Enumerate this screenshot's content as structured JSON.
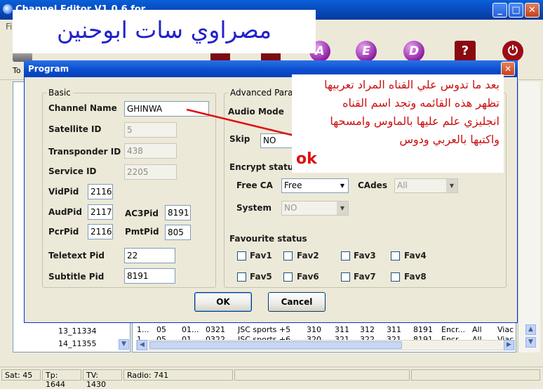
{
  "main_window": {
    "title": "Channel Editor V1.0.6 for ...",
    "menu_first": "File",
    "toolbar_label": "To",
    "overlay_banner": "مصراوي سات  ابوحنين",
    "tool_buttons": [
      "A",
      "E",
      "D",
      "?",
      "⏻"
    ]
  },
  "tree": {
    "items": [
      "13_11334",
      "14_11355"
    ]
  },
  "grid": {
    "rows": [
      [
        "1...",
        "05",
        "01...",
        "0321",
        "JSC sports +5",
        "310",
        "311",
        "312",
        "311",
        "8191",
        "Encr...",
        "All",
        "Viac"
      ],
      [
        "1...",
        "05",
        "01...",
        "0322",
        "JSC sports +6",
        "320",
        "321",
        "322",
        "321",
        "8191",
        "Encr...",
        "All",
        "Viac"
      ]
    ]
  },
  "statusbar": {
    "sat": "Sat: 45",
    "tp": "Tp: 1644",
    "tv": "TV: 1430",
    "radio": "Radio: 741"
  },
  "dialog": {
    "title": "Program",
    "basic": {
      "group_label": "Basic",
      "channel_name_label": "Channel Name",
      "channel_name_value": "GHINWA",
      "satellite_id_label": "Satellite ID",
      "satellite_id_value": "5",
      "transponder_id_label": "Transponder ID",
      "transponder_id_value": "438",
      "service_id_label": "Service ID",
      "service_id_value": "2205",
      "vidpid_label": "VidPid",
      "vidpid_value": "2116",
      "audpid_label": "AudPid",
      "audpid_value": "2117",
      "ac3pid_label": "AC3Pid",
      "ac3pid_value": "8191",
      "pcrpid_label": "PcrPid",
      "pcrpid_value": "2116",
      "pmtpid_label": "PmtPid",
      "pmtpid_value": "805",
      "teletext_label": "Teletext Pid",
      "teletext_value": "22",
      "subtitle_label": "Subtitle Pid",
      "subtitle_value": "8191"
    },
    "advanced": {
      "group_label": "Advanced Para",
      "audio_mode_label": "Audio Mode",
      "skip_label": "Skip",
      "skip_value": "NO",
      "encrypt_label": "Encrypt status",
      "free_ca_label": "Free CA",
      "free_ca_value": "Free",
      "cades_label": "CAdes",
      "cades_value": "All",
      "system_label": "System",
      "system_value": "NO",
      "favourite_label": "Favourite status",
      "favs": [
        "Fav1",
        "Fav2",
        "Fav3",
        "Fav4",
        "Fav5",
        "Fav6",
        "Fav7",
        "Fav8"
      ]
    },
    "ok_label": "OK",
    "cancel_label": "Cancel"
  },
  "annotation": {
    "lines": [
      "بعد ما تدوس علي القناه المراد تعربيها",
      "تظهر هذه القائمه وتجد اسم القناه",
      "انجليزي علم عليها بالماوس وامسحها",
      "واكتبها بالعربي ودوس"
    ],
    "ok_word": "ok",
    "color": "#cc1111"
  },
  "colors": {
    "titlebar": "#0a4ed0",
    "banner_text": "#2222cc"
  }
}
